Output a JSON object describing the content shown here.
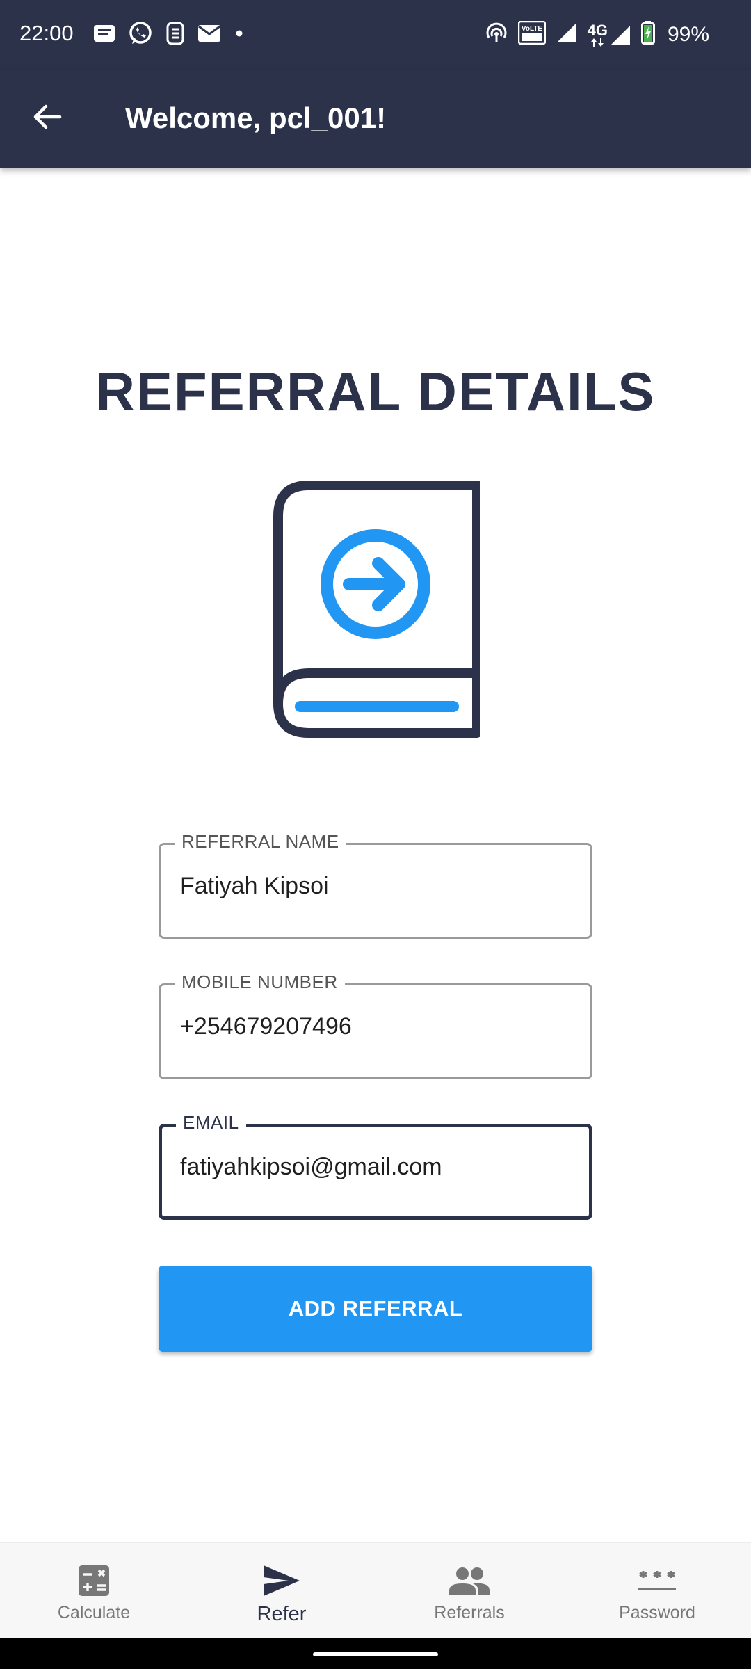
{
  "status_bar": {
    "time": "22:00",
    "left_icons": [
      "notification-icon",
      "whatsapp-icon",
      "sim-app-icon",
      "mail-icon",
      "dot-icon"
    ],
    "right_icons": [
      "hotspot-icon",
      "volte-icon",
      "signal-icon",
      "4g-signal-icon",
      "battery-icon"
    ],
    "network_type": "4G",
    "volte_label": "VoLTE",
    "battery_text": "99%"
  },
  "app_bar": {
    "title": "Welcome, pcl_001!",
    "back_icon": "arrow-left-icon"
  },
  "page": {
    "title": "REFERRAL DETAILS",
    "illustration_icon": "book-arrow-icon"
  },
  "form": {
    "referral_name": {
      "label": "REFERRAL NAME",
      "value": "Fatiyah Kipsoi"
    },
    "mobile_number": {
      "label": "MOBILE NUMBER",
      "value": "+254679207496"
    },
    "email": {
      "label": "EMAIL",
      "value": "fatiyahkipsoi@gmail.com"
    },
    "submit_label": "ADD REFERRAL"
  },
  "bottom_nav": {
    "items": [
      {
        "label": "Calculate",
        "icon": "calculator-icon",
        "active": false
      },
      {
        "label": "Refer",
        "icon": "send-icon",
        "active": true
      },
      {
        "label": "Referrals",
        "icon": "people-icon",
        "active": false
      },
      {
        "label": "Password",
        "icon": "password-icon",
        "active": false
      }
    ]
  },
  "colors": {
    "primary_dark": "#2b3249",
    "accent": "#2196f3",
    "background": "#ffffff"
  }
}
